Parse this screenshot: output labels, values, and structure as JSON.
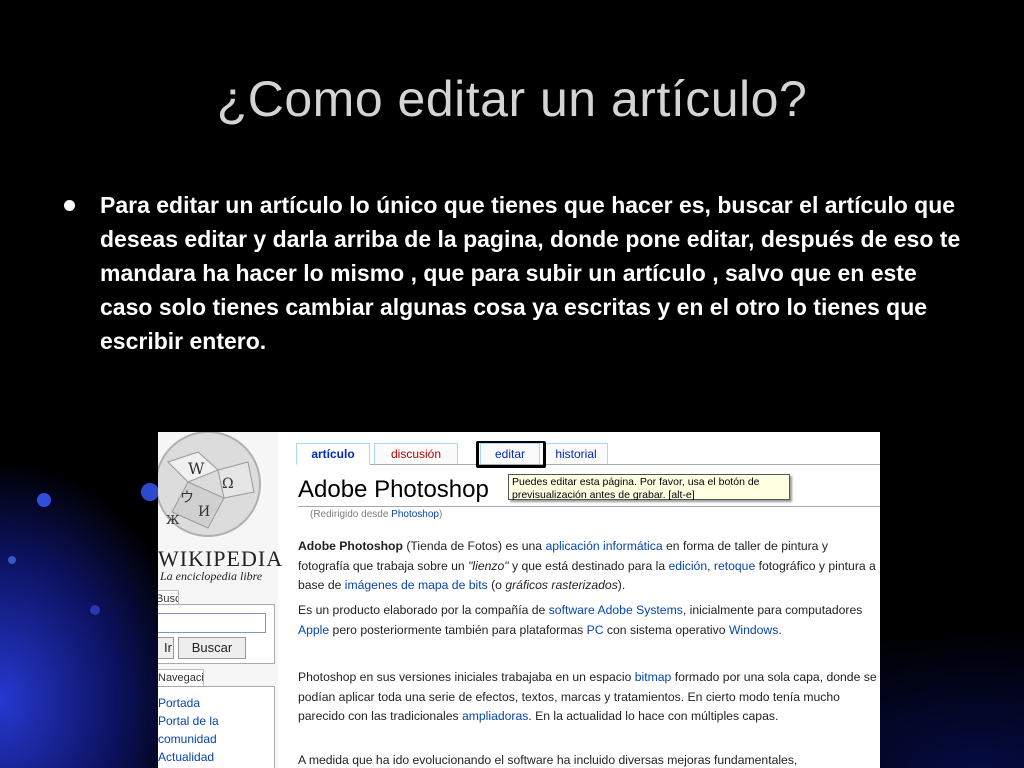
{
  "slide": {
    "title": "¿Como editar un artículo?",
    "bullet": "Para editar un artículo lo único que tienes que hacer es, buscar el artículo que deseas editar y darla arriba de la pagina, donde pone editar, después de eso te mandara ha hacer lo mismo , que para subir un artículo , salvo que en este caso solo tienes cambiar algunas cosa ya escritas y en el otro lo tienes que escribir entero."
  },
  "wiki": {
    "logo": {
      "name": "WIKIPEDIA",
      "tagline": "La enciclopedia libre"
    },
    "search": {
      "label": "Buscar",
      "button_ir": "Ir",
      "button_buscar": "Buscar"
    },
    "nav": {
      "label": "Navegación",
      "items": [
        "Portada",
        "Portal de la",
        "comunidad",
        "Actualidad"
      ]
    },
    "tabs": [
      "artículo",
      "discusión",
      "editar",
      "historial"
    ],
    "tooltip": [
      "Puedes editar esta página. Por favor, usa el botón de",
      "previsualización antes de grabar. [alt-e]"
    ],
    "article": {
      "title": "Adobe Photoshop",
      "redirect_prefix": "(Redirigido desde ",
      "redirect_link": "Photoshop",
      "redirect_suffix": ")",
      "p1": {
        "a": "Adobe Photoshop",
        "b": " (Tienda de Fotos) es una ",
        "c": "aplicación informática",
        "d": " en forma de taller de pintura y fotografía que trabaja sobre un ",
        "e": "\"lienzo\"",
        "f": " y que está destinado para la ",
        "g": "edición",
        "h": ", ",
        "i": "retoque",
        "j": " fotográfico y pintura a base de ",
        "k": "imágenes de mapa de bits",
        "l": " (o ",
        "m": "gráficos rasterizados",
        "n": ")."
      },
      "p2": {
        "a": "Es un producto elaborado por la compañía de ",
        "b": "software Adobe Systems",
        "c": ", inicialmente para computadores ",
        "d": "Apple",
        "e": " pero posteriormente también para plataformas ",
        "f": "PC",
        "g": " con sistema operativo ",
        "h": "Windows",
        "i": "."
      },
      "p3": {
        "a": "Photoshop en sus versiones iniciales trabajaba en un espacio ",
        "b": "bitmap",
        "c": " formado por una sola capa, donde se podían aplicar toda una serie de efectos, textos, marcas y tratamientos. En cierto modo tenía mucho parecido con las tradicionales ",
        "d": "ampliadoras",
        "e": ". En la actualidad lo hace con múltiples capas."
      },
      "p4": "A medida que ha ido evolucionando el software ha incluido diversas mejoras fundamentales,"
    }
  }
}
